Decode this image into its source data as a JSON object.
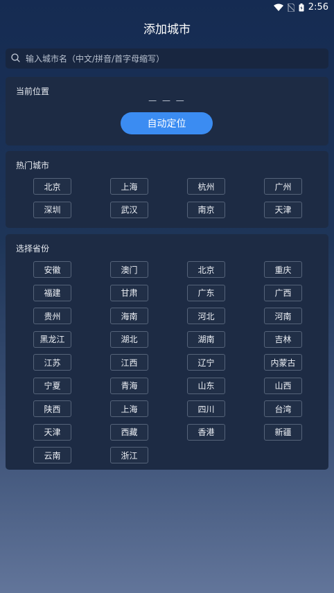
{
  "status": {
    "time": "2:56"
  },
  "header": {
    "title": "添加城市"
  },
  "search": {
    "placeholder": "输入城市名（中文/拼音/首字母缩写）"
  },
  "current": {
    "title": "当前位置",
    "location": "— — —",
    "auto_locate_label": "自动定位"
  },
  "hot": {
    "title": "热门城市",
    "cities": [
      "北京",
      "上海",
      "杭州",
      "广州",
      "深圳",
      "武汉",
      "南京",
      "天津"
    ]
  },
  "provinces": {
    "title": "选择省份",
    "items": [
      "安徽",
      "澳门",
      "北京",
      "重庆",
      "福建",
      "甘肃",
      "广东",
      "广西",
      "贵州",
      "海南",
      "河北",
      "河南",
      "黑龙江",
      "湖北",
      "湖南",
      "吉林",
      "江苏",
      "江西",
      "辽宁",
      "内蒙古",
      "宁夏",
      "青海",
      "山东",
      "山西",
      "陕西",
      "上海",
      "四川",
      "台湾",
      "天津",
      "西藏",
      "香港",
      "新疆",
      "云南",
      "浙江"
    ]
  }
}
